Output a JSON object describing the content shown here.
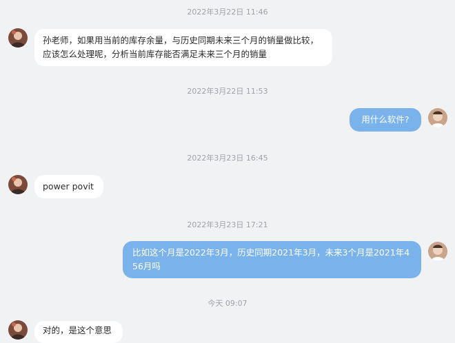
{
  "messages": [
    {
      "time": "2022年3月22日 11:46",
      "side": "in",
      "text": "孙老师，如果用当前的库存余量，与历史同期未来三个月的销量做比较，应该怎么处理呢，分析当前库存能否满足未来三个月的销量"
    },
    {
      "time": "2022年3月22日 11:53",
      "side": "out",
      "text": "用什么软件?"
    },
    {
      "time": "2022年3月23日 16:45",
      "side": "in",
      "text": "power povit"
    },
    {
      "time": "2022年3月23日 17:21",
      "side": "out",
      "text": "比如这个月是2022年3月，历史同期2021年3月，未来3个月是2021年456月吗"
    },
    {
      "time": "今天 09:07",
      "side": "in",
      "text": "对的，是这个意思"
    }
  ],
  "avatars": {
    "other": {
      "icon": "user-avatar-icon",
      "color": "#7a4a3a"
    },
    "self": {
      "icon": "user-avatar-icon",
      "color": "#c9a48a"
    }
  },
  "colors": {
    "background": "#f1f2f4",
    "incoming_bubble": "#ffffff",
    "outgoing_bubble": "#7ab3ec"
  }
}
